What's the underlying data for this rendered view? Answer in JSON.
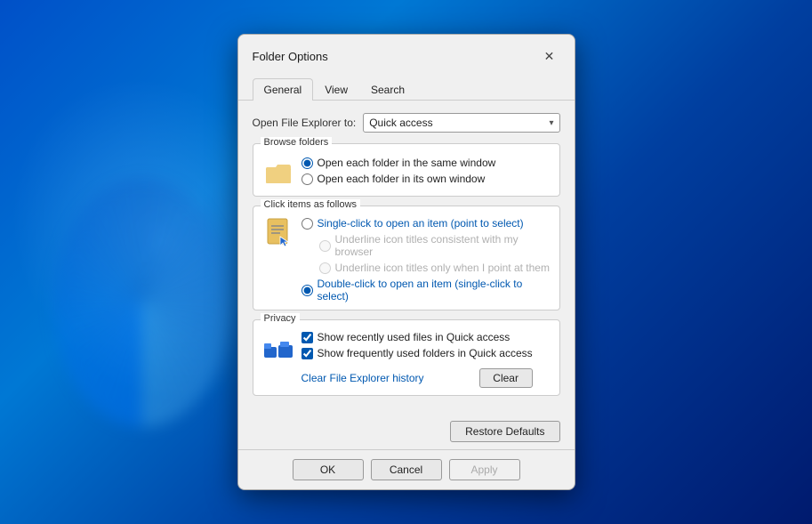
{
  "dialog": {
    "title": "Folder Options",
    "close_label": "✕"
  },
  "tabs": [
    {
      "id": "general",
      "label": "General",
      "active": true
    },
    {
      "id": "view",
      "label": "View",
      "active": false
    },
    {
      "id": "search",
      "label": "Search",
      "active": false
    }
  ],
  "open_explorer": {
    "label": "Open File Explorer to:",
    "value": "Quick access",
    "dropdown_arrow": "▾"
  },
  "browse_folders": {
    "title": "Browse folders",
    "options": [
      {
        "id": "same-window",
        "label": "Open each folder in the same window",
        "checked": true
      },
      {
        "id": "own-window",
        "label": "Open each folder in its own window",
        "checked": false
      }
    ]
  },
  "click_items": {
    "title": "Click items as follows",
    "options": [
      {
        "id": "single-click",
        "label": "Single-click to open an item (point to select)",
        "checked": false,
        "highlighted": true
      },
      {
        "id": "underline-consistent",
        "label": "Underline icon titles consistent with my browser",
        "checked": false,
        "disabled": true,
        "indented": true
      },
      {
        "id": "underline-hover",
        "label": "Underline icon titles only when I point at them",
        "checked": false,
        "disabled": true,
        "indented": true
      },
      {
        "id": "double-click",
        "label": "Double-click to open an item (single-click to select)",
        "checked": true,
        "highlighted": true
      }
    ]
  },
  "privacy": {
    "title": "Privacy",
    "options": [
      {
        "id": "recent-files",
        "label": "Show recently used files in Quick access",
        "checked": true
      },
      {
        "id": "frequent-folders",
        "label": "Show frequently used folders in Quick access",
        "checked": true
      }
    ],
    "clear_label": "Clear File Explorer history",
    "clear_button": "Clear"
  },
  "restore_defaults": "Restore Defaults",
  "footer": {
    "ok": "OK",
    "cancel": "Cancel",
    "apply": "Apply"
  },
  "colors": {
    "accent": "#0058b0",
    "link": "#0058b0",
    "highlight_text": "#0058b0",
    "disabled_text": "#b0b0b0"
  }
}
